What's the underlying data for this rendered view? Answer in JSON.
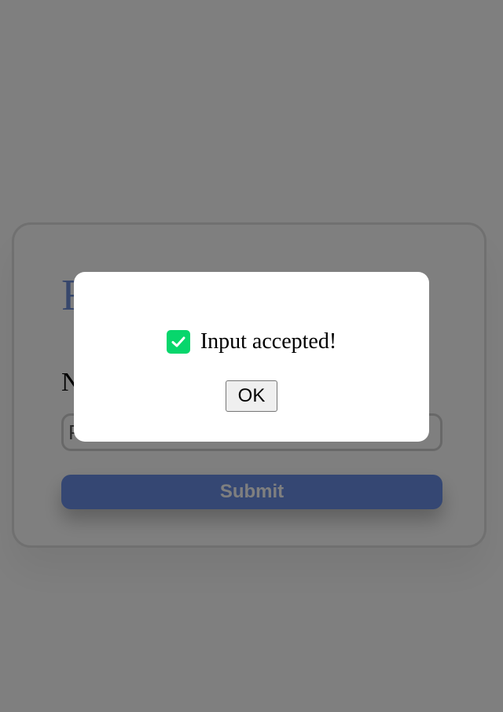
{
  "form": {
    "title": "F",
    "field_label": "N",
    "input_placeholder": "P",
    "submit_label": "Submit"
  },
  "modal": {
    "icon": "check-icon",
    "message": "Input accepted!",
    "ok_label": "OK"
  },
  "colors": {
    "accent": "#6a8fe6",
    "success": "#07d66c",
    "overlay": "rgba(0,0,0,0.5)"
  }
}
